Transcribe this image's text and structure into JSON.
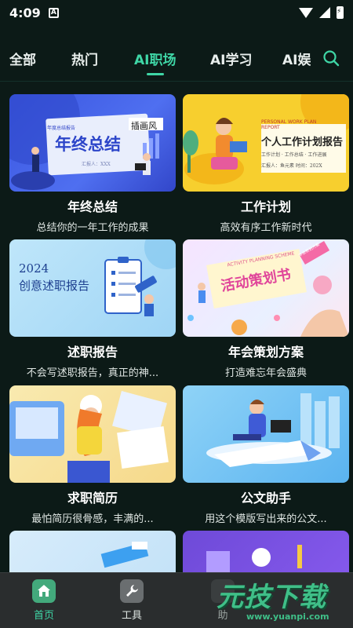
{
  "status_bar": {
    "time": "4:09",
    "badge": "A"
  },
  "tabs": [
    {
      "label": "全部",
      "active": false
    },
    {
      "label": "热门",
      "active": false
    },
    {
      "label": "AI职场",
      "active": true
    },
    {
      "label": "AI学习",
      "active": false
    },
    {
      "label": "AI娱",
      "active": false
    }
  ],
  "search_icon": "search-icon",
  "cards": [
    {
      "title": "年终总结",
      "desc": "总结你的一年工作的成果",
      "thumb_heading": "年终总结",
      "thumb_tag": "插画风",
      "thumb_sub": "汇报人：XXX",
      "thumb_top": "年度总结报告"
    },
    {
      "title": "工作计划",
      "desc": "高效有序工作新时代",
      "thumb_en": "PERSONAL WORK PLAN REPORT",
      "thumb_heading": "个人工作计划报告",
      "thumb_chips": "工作计划 · 工作总结 · 工作进展",
      "thumb_sub": "汇报人：鱼元素  时间：202X"
    },
    {
      "title": "述职报告",
      "desc": "不会写述职报告，真正的神...",
      "thumb_year": "2024",
      "thumb_heading": "创意述职报告"
    },
    {
      "title": "年会策划方案",
      "desc": "打造难忘年会盛典",
      "thumb_en": "ACTIVITY PLANNING SCHEME",
      "thumb_heading": "活动策划书",
      "thumb_tag": "年会策划方案"
    },
    {
      "title": "求职简历",
      "desc": "最怕简历很骨感，丰满的..."
    },
    {
      "title": "公文助手",
      "desc": "用这个模版写出来的公文..."
    }
  ],
  "bottom_nav": [
    {
      "label": "首页",
      "icon": "home-icon",
      "active": true
    },
    {
      "label": "工具",
      "icon": "wrench-icon",
      "active": false
    },
    {
      "label": "助",
      "icon": "assistant-icon",
      "active": false
    }
  ],
  "watermark": {
    "text": "元技下载",
    "url": "www.yuanpi.com"
  },
  "colors": {
    "accent": "#3fd6a6",
    "background": "#0c1a17",
    "nav_bg": "#2a2d2e"
  }
}
